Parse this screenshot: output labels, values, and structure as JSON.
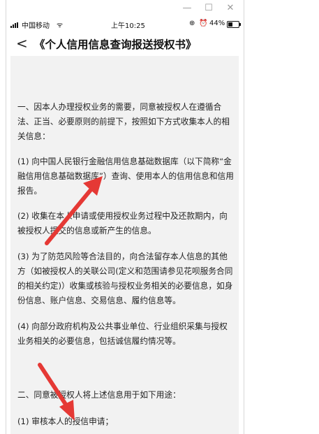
{
  "status": {
    "carrier": "中国移动",
    "time": "上午10:25",
    "battery": "44%"
  },
  "nav": {
    "back_icon": "chevron-left-icon",
    "title": "《个人信用信息查询报送授权书》"
  },
  "document": {
    "p1": "一、因本人办理授权业务的需要，同意被授权人在遵循合法、正当、必要原则的前提下，按照如下方式收集本人的相关信息：",
    "p2": "(1) 向中国人民银行金融信用信息基础数据库（以下简称“金融信用信息基础数据库”）查询、使用本人的信用信息和信用报告。",
    "p3": "(2) 收集在本人申请或使用授权业务过程中及还款期内，向被授权人提交的信息或新产生的信息。",
    "p4": "(3) 为了防范风险等合法目的，向合法留存本人信息的其他方（如被授权人的关联公司(定义和范围请参见花呗服务合同的相关约定)）收集或核验与授权业务相关的必要信息，如身份信息、账户信息、交易信息、履约信息等。",
    "p5": "(4) 向部分政府机构及公共事业单位、行业组织采集与授权业务相关的必要信息，包括诚信履约情况等。",
    "p6": "二、同意被授权人将上述信息用于如下用途：",
    "p7": "(1) 审核本人的授信申请；"
  },
  "colors": {
    "arrow": "#e53935",
    "doc_bg": "#f2f2f2"
  }
}
